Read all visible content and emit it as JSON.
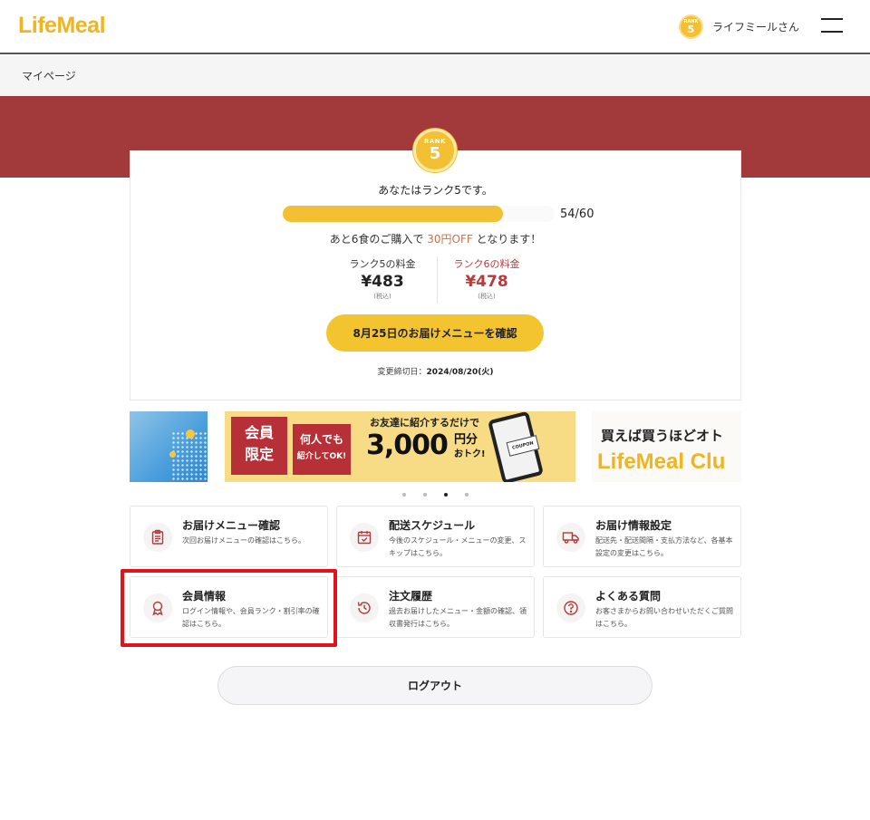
{
  "header": {
    "logo": "LifeMeal",
    "user_badge_rank_label": "RANK",
    "user_badge_rank": "5",
    "user_name": "ライフミールさん"
  },
  "breadcrumb": "マイページ",
  "rank_card": {
    "badge_label": "RANK",
    "badge_rank": "5",
    "rank_message": "あなたはランク5です。",
    "progress_current": 54,
    "progress_total": 60,
    "progress_text": "54/60",
    "discount_prefix": "あと6食のご購入で",
    "discount_highlight": "30円OFF",
    "discount_suffix": "となります！",
    "current_price_label": "ランク5の料金",
    "current_price": "¥483",
    "current_price_tax": "(税込)",
    "next_price_label": "ランク6の料金",
    "next_price": "¥478",
    "next_price_tax": "(税込)",
    "confirm_button": "8月25日のお届けメニューを確認",
    "deadline_label": "変更締切日：",
    "deadline_date": "2024/08/20(火)"
  },
  "banners": {
    "main_tag1": "会員\n限定",
    "main_tag2_big": "何人でも",
    "main_tag2_small": "紹介してOK!",
    "main_headline": "お友達に紹介するだけで",
    "main_amount": "3,000",
    "main_amount_sub1": "円分",
    "main_amount_sub2": "おトク!",
    "main_coupon": "COUPON",
    "right_title": "買えば買うほどオト",
    "right_logo": "LifeMeal Clu",
    "active_dot": 3,
    "dot_count": 4
  },
  "menu": [
    {
      "title": "お届けメニュー確認",
      "desc": "次回お届けメニューの確認はこちら。",
      "icon": "clipboard-icon"
    },
    {
      "title": "配送スケジュール",
      "desc": "今後のスケジュール・メニューの変更、スキップはこちら。",
      "icon": "calendar-icon"
    },
    {
      "title": "お届け情報設定",
      "desc": "配送先・配送間隔・支払方法など、各基本設定の変更はこちら。",
      "icon": "truck-icon"
    },
    {
      "title": "会員情報",
      "desc": "ログイン情報や、会員ランク・割引率の確認はこちら。",
      "icon": "award-icon"
    },
    {
      "title": "注文履歴",
      "desc": "過去お届けしたメニュー・金額の確認、領収書発行はこちら。",
      "icon": "history-icon"
    },
    {
      "title": "よくある質問",
      "desc": "お客さまからお問い合わせいただくご質問はこちら。",
      "icon": "question-icon"
    }
  ],
  "logout_button": "ログアウト",
  "colors": {
    "brand_yellow": "#f2c032",
    "brand_red": "#a23a3c",
    "highlight_red": "#e0141a"
  }
}
